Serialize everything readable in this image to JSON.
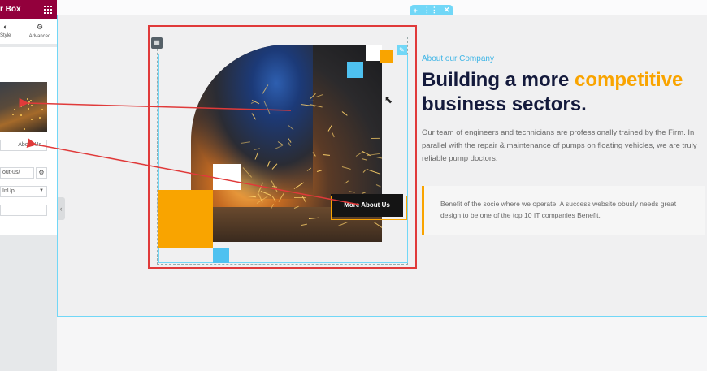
{
  "editor_panel": {
    "title": "r Box",
    "tabs": [
      {
        "label": "Style",
        "icon": "half-circle-icon"
      },
      {
        "label": "Advanced",
        "icon": "gear-icon"
      }
    ],
    "title_field_value": "About Us",
    "link_field_value": "out-us/",
    "animation_value": "InUp"
  },
  "canvas": {
    "section_handle": {
      "add": "+",
      "drag": "⋮⋮",
      "close": "✕"
    },
    "more_button_label": "More About Us"
  },
  "content": {
    "eyebrow": "About our Company",
    "heading_part1": "Building a more ",
    "heading_accent": "competitive",
    "heading_part2": " business sectors.",
    "body": "Our team of engineers and technicians are professionally trained by the Firm. In parallel with the repair & maintenance of pumps on floating vehicles, we are truly reliable pump doctors.",
    "quote": "Benefit of the socie where we operate. A success website obusly needs great design to be one of the top 10 IT companies Benefit."
  },
  "colors": {
    "panel_header": "#93003c",
    "accent_orange": "#f9a400",
    "accent_blue": "#4ec1f0",
    "heading_navy": "#141a3c",
    "annotation_red": "#e03a3a",
    "selection_cyan": "#71d7f7"
  }
}
